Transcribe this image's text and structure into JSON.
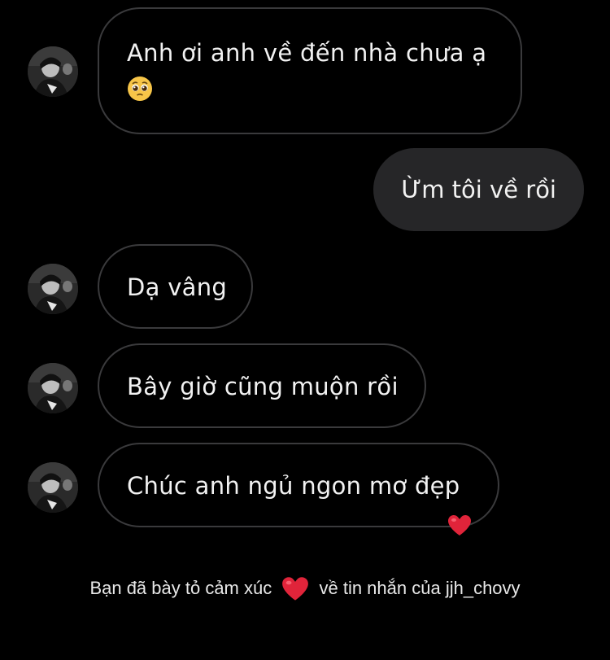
{
  "messages": [
    {
      "direction": "incoming",
      "text": "Anh ơi anh về đến nhà chưa ạ",
      "emoji": "pleading-face-icon"
    },
    {
      "direction": "outgoing",
      "text": "Ừm tôi về rồi"
    },
    {
      "direction": "incoming",
      "text": "Dạ vâng"
    },
    {
      "direction": "incoming",
      "text": "Bây giờ cũng muộn rồi"
    },
    {
      "direction": "incoming",
      "text": "Chúc anh ngủ ngon mơ đẹp",
      "reaction": "red-heart-icon"
    }
  ],
  "footer": {
    "before": "Bạn đã bày tỏ cảm xúc",
    "icon": "red-heart-icon",
    "after": "về tin nhắn của jjh_chovy"
  },
  "colors": {
    "background": "#000000",
    "incoming_border": "#3a3a3c",
    "outgoing_bubble": "#262628",
    "heart": "#e0243a"
  }
}
